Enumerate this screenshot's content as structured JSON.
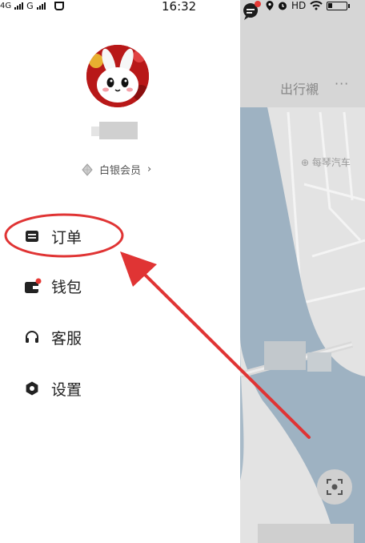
{
  "status_bar": {
    "carrier_left": "4G",
    "carrier_second": "G",
    "time": "16:32",
    "hd_label": "HD"
  },
  "profile": {
    "member_level": "白银会员",
    "member_chevron": "›"
  },
  "menu": {
    "items": [
      {
        "label": "订单",
        "icon": "order-icon"
      },
      {
        "label": "钱包",
        "icon": "wallet-icon",
        "badge": true
      },
      {
        "label": "客服",
        "icon": "headset-icon"
      },
      {
        "label": "设置",
        "icon": "settings-icon"
      }
    ]
  },
  "map": {
    "header_tab": "出行襯",
    "more": "···",
    "separator": ":",
    "poi_label": "⊕ 每琴汽车"
  },
  "colors": {
    "annotation_red": "#e03434",
    "badge_red": "#e53935",
    "water": "#9fb3c3",
    "map_land": "#e6e6e6"
  }
}
